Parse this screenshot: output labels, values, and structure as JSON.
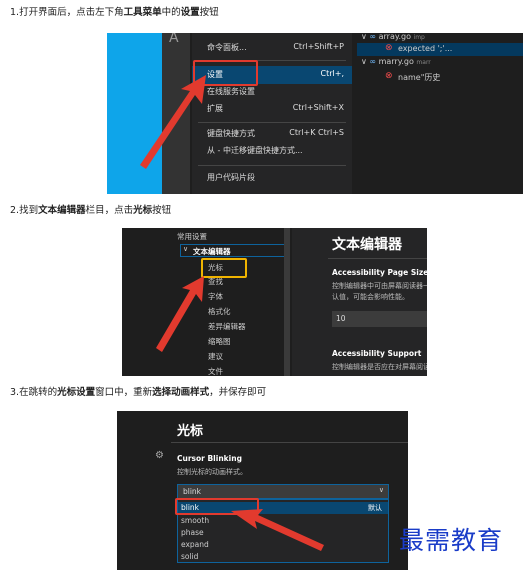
{
  "steps": [
    {
      "pre": "1.打开界面后，点击左下角",
      "bold": "工具菜单",
      "mid": "中的",
      "bold2": "设置",
      "post": "按钮"
    },
    {
      "pre": "2.找到",
      "bold": "文本编辑器",
      "mid": "栏目，点击",
      "bold2": "光标",
      "post": "按钮"
    },
    {
      "pre": "3.在跳转的",
      "bold": "光标设置",
      "mid": "窗口中，重新",
      "bold2": "选择动画样式",
      "post": "，并保存即可"
    }
  ],
  "shot1": {
    "menu": [
      {
        "label": "命令面板...",
        "shortcut": "Ctrl+Shift+P"
      },
      {
        "label": "设置",
        "shortcut": "Ctrl+,"
      },
      {
        "label": "在线服务设置",
        "shortcut": ""
      },
      {
        "label": "扩展",
        "shortcut": "Ctrl+Shift+X"
      },
      {
        "label": "键盘快捷方式",
        "shortcut": "Ctrl+K Ctrl+S"
      },
      {
        "label": "从 - 中迁移键盘快捷方式...",
        "shortcut": ""
      },
      {
        "label": "用户代码片段",
        "shortcut": ""
      }
    ],
    "problems": [
      {
        "file": "array.go",
        "suffix": "imp"
      },
      {
        "error": "expected ';'..."
      },
      {
        "file": "marry.go",
        "suffix": "marr"
      },
      {
        "error": "name\"历史"
      }
    ],
    "explorer_letter": "A"
  },
  "shot2": {
    "tree": [
      "常用设置",
      "文本编辑器",
      "光标",
      "查找",
      "字体",
      "格式化",
      "差异编辑器",
      "缩略图",
      "建议",
      "文件"
    ],
    "heading": "文本编辑器",
    "setting_title": "Accessibility Page Size",
    "setting_desc": "控制编辑器中可由屏幕阅读器一次读出的行数，默认值",
    "setting_desc2": "认值，可能会影响性能。",
    "input_value": "10",
    "setting2_title": "Accessibility Support",
    "setting2_desc": "控制编辑器是否应在对屏幕阅读器进行优化的模式下运行"
  },
  "shot3": {
    "heading": "光标",
    "setting_title": "Cursor Blinking",
    "setting_desc": "控制光标的动画样式。",
    "select_value": "blink",
    "options": [
      "blink",
      "smooth",
      "phase",
      "expand",
      "solid"
    ],
    "default_label": "默认"
  },
  "watermark": "最需教育"
}
